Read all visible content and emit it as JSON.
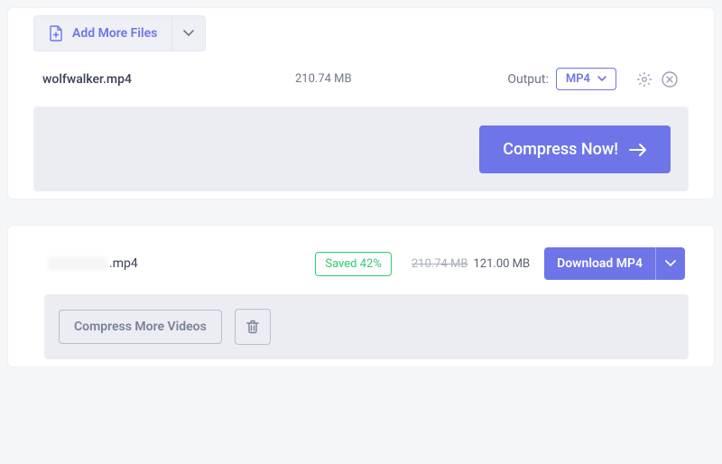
{
  "upload": {
    "add_more_label": "Add More Files",
    "file": {
      "name": "wolfwalker.mp4",
      "size": "210.74 MB",
      "output_label": "Output:",
      "output_format": "MP4"
    },
    "compress_label": "Compress Now!"
  },
  "result": {
    "file_ext": ".mp4",
    "saved_label": "Saved 42%",
    "old_size": "210.74 MB",
    "new_size": "121.00 MB",
    "download_label": "Download MP4",
    "compress_more_label": "Compress More Videos"
  }
}
